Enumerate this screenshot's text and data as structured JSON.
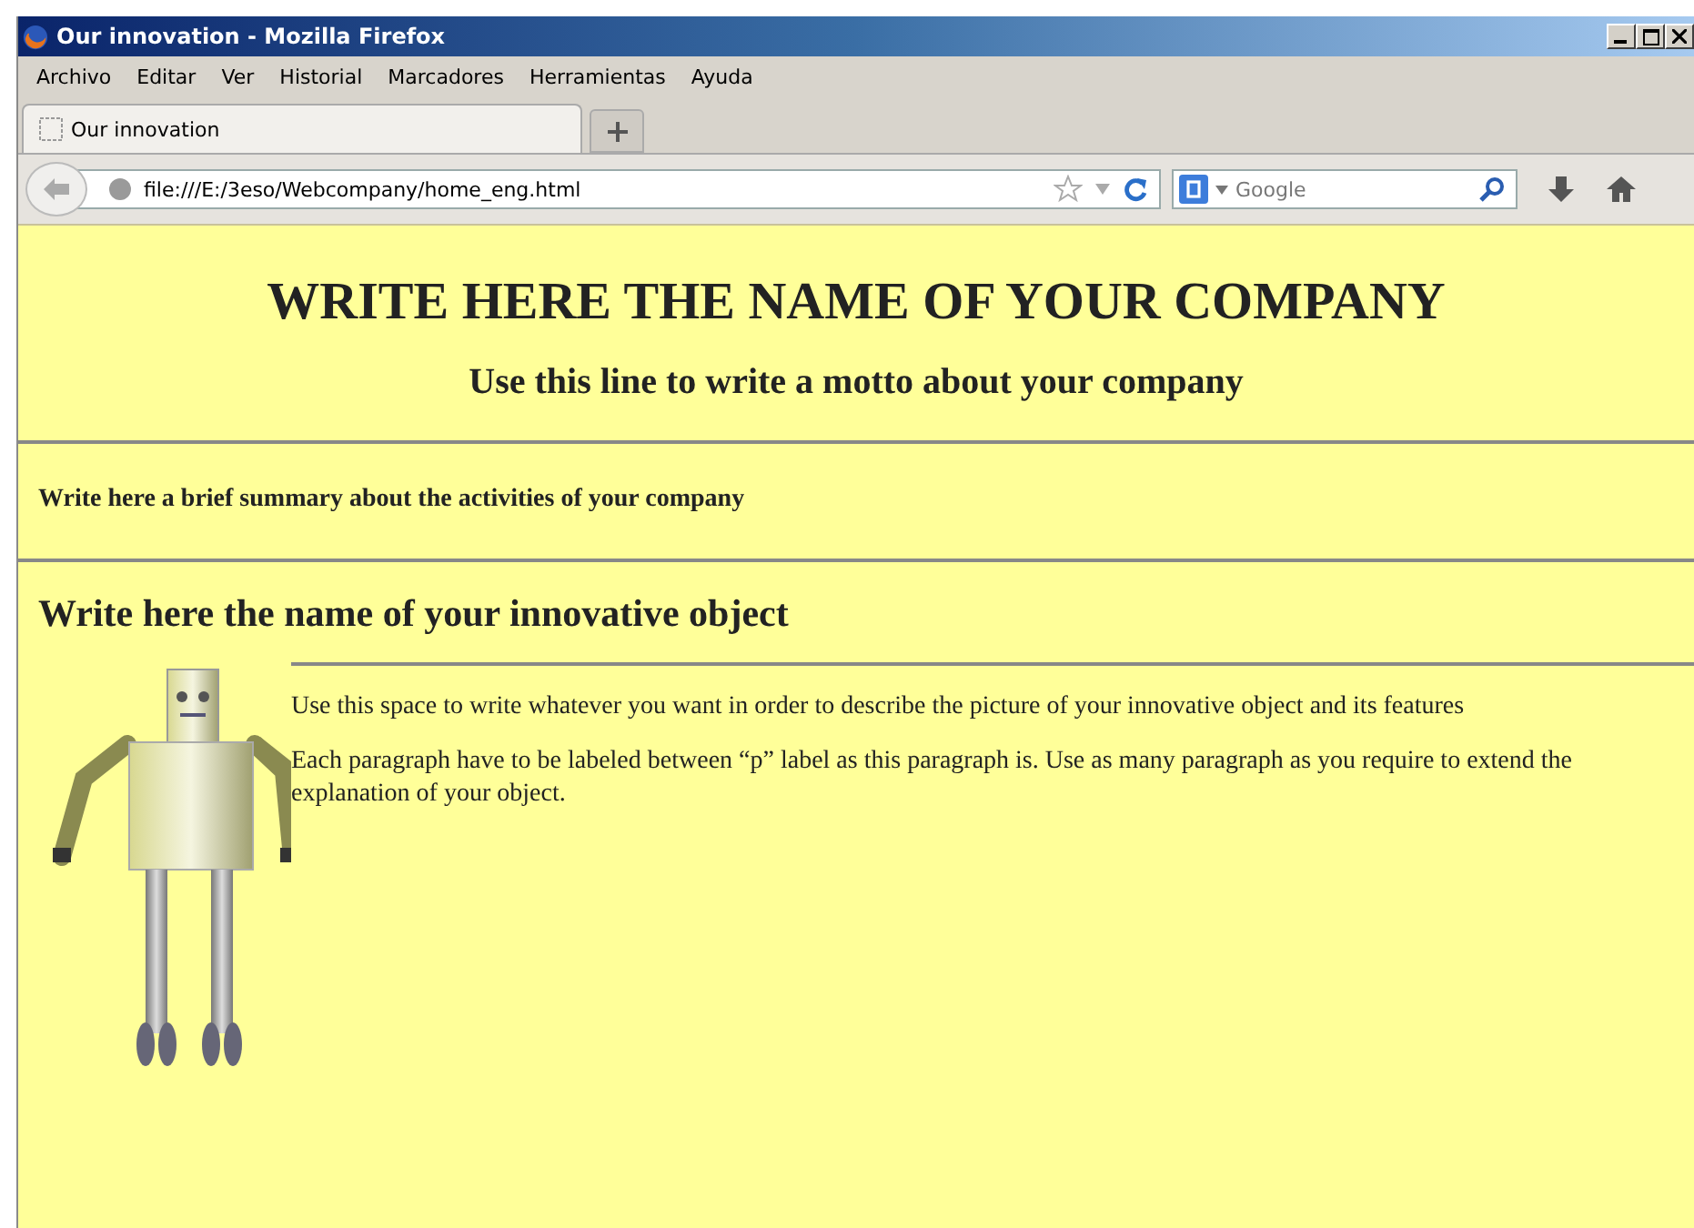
{
  "window": {
    "title": "Our innovation - Mozilla Firefox"
  },
  "menu": [
    "Archivo",
    "Editar",
    "Ver",
    "Historial",
    "Marcadores",
    "Herramientas",
    "Ayuda"
  ],
  "tabs": [
    {
      "label": "Our innovation",
      "selected": true
    }
  ],
  "address": {
    "value": "file:///E:/3eso/Webcompany/home_eng.html"
  },
  "search": {
    "engine": "Google"
  },
  "page": {
    "company": "WRITE HERE THE NAME OF YOUR COMPANY",
    "motto": "Use this line to write a motto about your company",
    "summary": "Write here a brief summary about the activities of your company",
    "object_title": "Write here the name of your innovative object",
    "paragraphs": [
      "Use this space to write whatever you want in order to describe the picture of your innovative object and its features",
      "Each paragraph have to be labeled between “p” label as this paragraph is. Use as many paragraph as you require to extend the explanation of your object."
    ]
  }
}
